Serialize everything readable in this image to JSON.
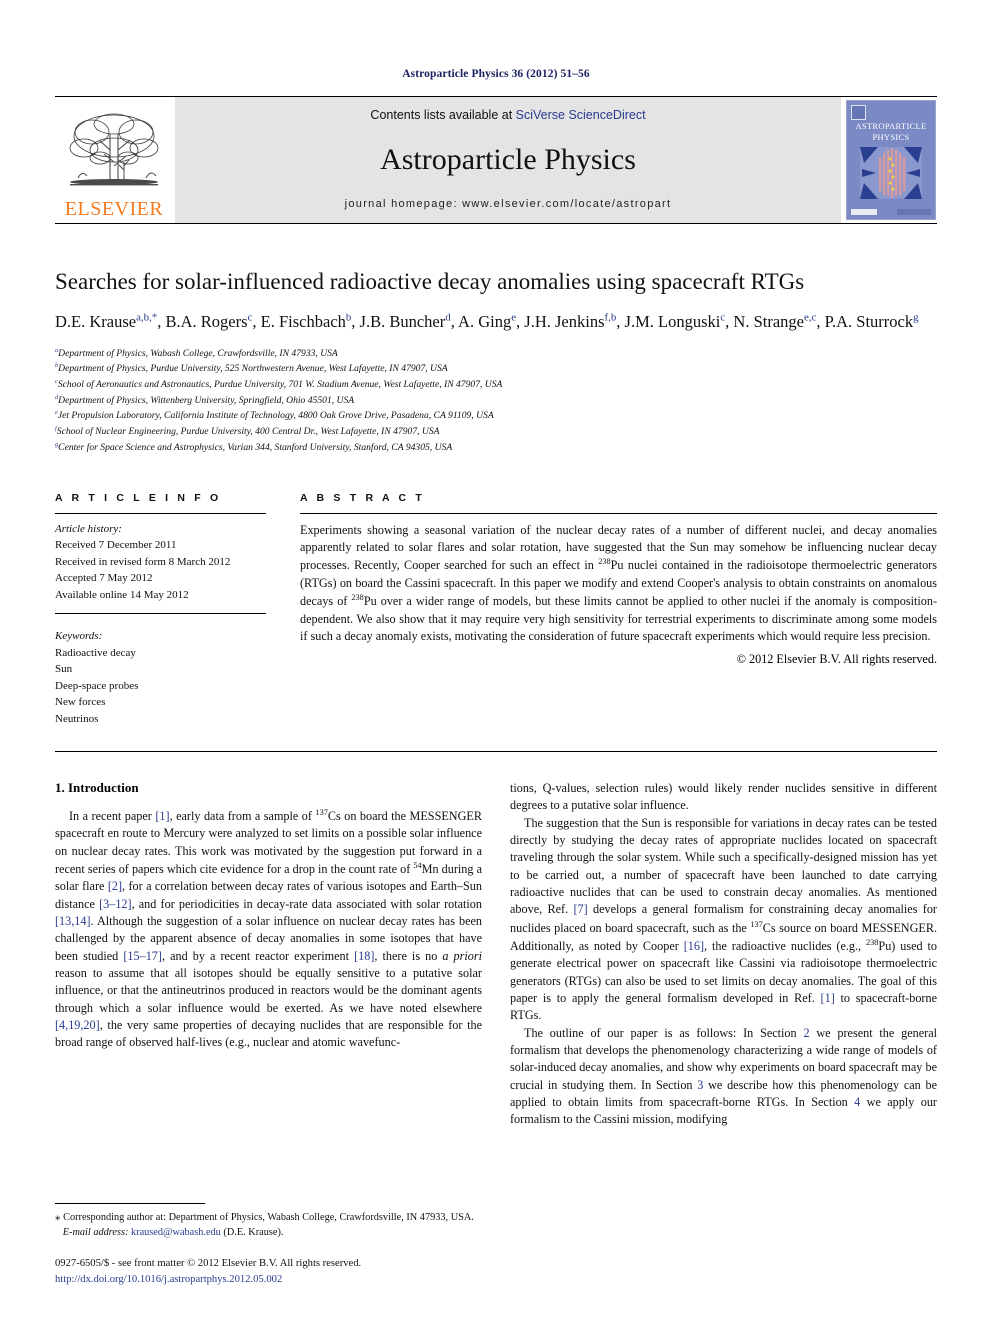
{
  "running_head": "Astroparticle Physics 36 (2012) 51–56",
  "masthead": {
    "publisher_name": "ELSEVIER",
    "contents_prefix": "Contents lists available at ",
    "contents_link": "SciVerse ScienceDirect",
    "journal_name": "Astroparticle Physics",
    "homepage": "journal homepage: www.elsevier.com/locate/astropart",
    "cover_title_line1": "ASTROPARTICLE",
    "cover_title_line2": "PHYSICS"
  },
  "article": {
    "title": "Searches for solar-influenced radioactive decay anomalies using spacecraft RTGs",
    "authors": [
      {
        "name": "D.E. Krause",
        "marks": "a,b,*"
      },
      {
        "name": "B.A. Rogers",
        "marks": "c"
      },
      {
        "name": "E. Fischbach",
        "marks": "b"
      },
      {
        "name": "J.B. Buncher",
        "marks": "d"
      },
      {
        "name": "A. Ging",
        "marks": "e"
      },
      {
        "name": "J.H. Jenkins",
        "marks": "f,b"
      },
      {
        "name": "J.M. Longuski",
        "marks": "c"
      },
      {
        "name": "N. Strange",
        "marks": "e,c"
      },
      {
        "name": "P.A. Sturrock",
        "marks": "g"
      }
    ],
    "affiliations": [
      {
        "mark": "a",
        "text": "Department of Physics, Wabash College, Crawfordsville, IN 47933, USA"
      },
      {
        "mark": "b",
        "text": "Department of Physics, Purdue University, 525 Northwestern Avenue, West Lafayette, IN 47907, USA"
      },
      {
        "mark": "c",
        "text": "School of Aeronautics and Astronautics, Purdue University, 701 W. Stadium Avenue, West Lafayette, IN 47907, USA"
      },
      {
        "mark": "d",
        "text": "Department of Physics, Wittenberg University, Springfield, Ohio 45501, USA"
      },
      {
        "mark": "e",
        "text": "Jet Propulsion Laboratory, California Institute of Technology, 4800 Oak Grove Drive, Pasadena, CA 91109, USA"
      },
      {
        "mark": "f",
        "text": "School of Nuclear Engineering, Purdue University, 400 Central Dr., West Lafayette, IN 47907, USA"
      },
      {
        "mark": "g",
        "text": "Center for Space Science and Astrophysics, Varian 344, Stanford University, Stanford, CA 94305, USA"
      }
    ]
  },
  "article_info": {
    "heading": "A R T I C L E    I N F O",
    "history_label": "Article history:",
    "history": [
      "Received 7 December 2011",
      "Received in revised form 8 March 2012",
      "Accepted 7 May 2012",
      "Available online 14 May 2012"
    ],
    "keywords_label": "Keywords:",
    "keywords": [
      "Radioactive decay",
      "Sun",
      "Deep-space probes",
      "New forces",
      "Neutrinos"
    ]
  },
  "abstract": {
    "heading": "A B S T R A C T",
    "copyright": "© 2012 Elsevier B.V. All rights reserved."
  },
  "introduction": {
    "heading": "1. Introduction"
  },
  "footnotes": {
    "corresponding": "Corresponding author at: Department of Physics, Wabash College, Crawfordsville, IN 47933, USA.",
    "email_label": "E-mail address:",
    "email": "kraused@wabash.edu",
    "email_suffix": "(D.E. Krause).",
    "imprint": "0927-6505/$ - see front matter © 2012 Elsevier B.V. All rights reserved.",
    "doi": "http://dx.doi.org/10.1016/j.astropartphys.2012.05.002"
  },
  "colors": {
    "link": "#2b3a8f",
    "elsevier_orange": "#F47B20",
    "band_gray": "#e4e4e4",
    "running_head": "#1c2260"
  }
}
